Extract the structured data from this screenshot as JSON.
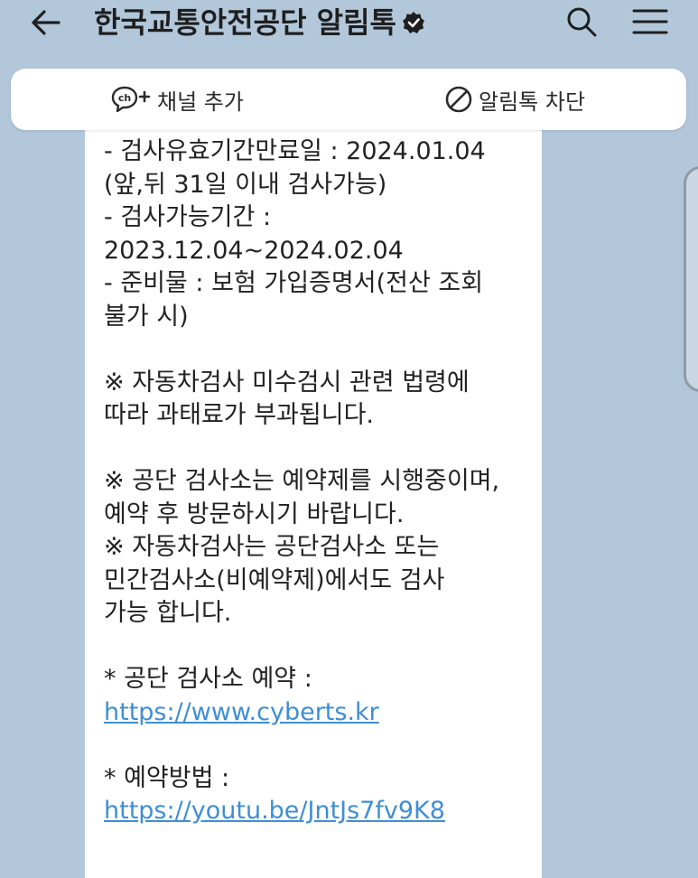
{
  "header": {
    "title": "한국교통안전공단 알림톡"
  },
  "actions": {
    "add_channel_label": "채널 추가",
    "block_label": "알림톡 차단"
  },
  "message": {
    "lines": [
      "- 검사유효기간만료일 : 2024.01.04",
      "(앞,뒤 31일 이내 검사가능)",
      "- 검사가능기간 :",
      "2023.12.04~2024.02.04",
      "- 준비물 : 보험 가입증명서(전산 조회",
      "불가 시)",
      "",
      "※ 자동차검사 미수검시 관련 법령에",
      "따라 과태료가 부과됩니다.",
      "",
      "※ 공단 검사소는 예약제를 시행중이며,",
      "예약 후 방문하시기 바랍니다.",
      "※ 자동차검사는 공단검사소 또는",
      "민간검사소(비예약제)에서도 검사",
      "가능 합니다.",
      "",
      "* 공단 검사소 예약 :"
    ],
    "reservation_link": "https://www.cyberts.kr",
    "method_label": "* 예약방법 :",
    "method_link": "https://youtu.be/JntJs7fv9K8"
  },
  "colors": {
    "background": "#b2c7da",
    "link": "#3f8ed6"
  },
  "icons": [
    "back-arrow-icon",
    "verified-badge-icon",
    "search-icon",
    "menu-icon",
    "channel-add-icon",
    "block-icon"
  ]
}
